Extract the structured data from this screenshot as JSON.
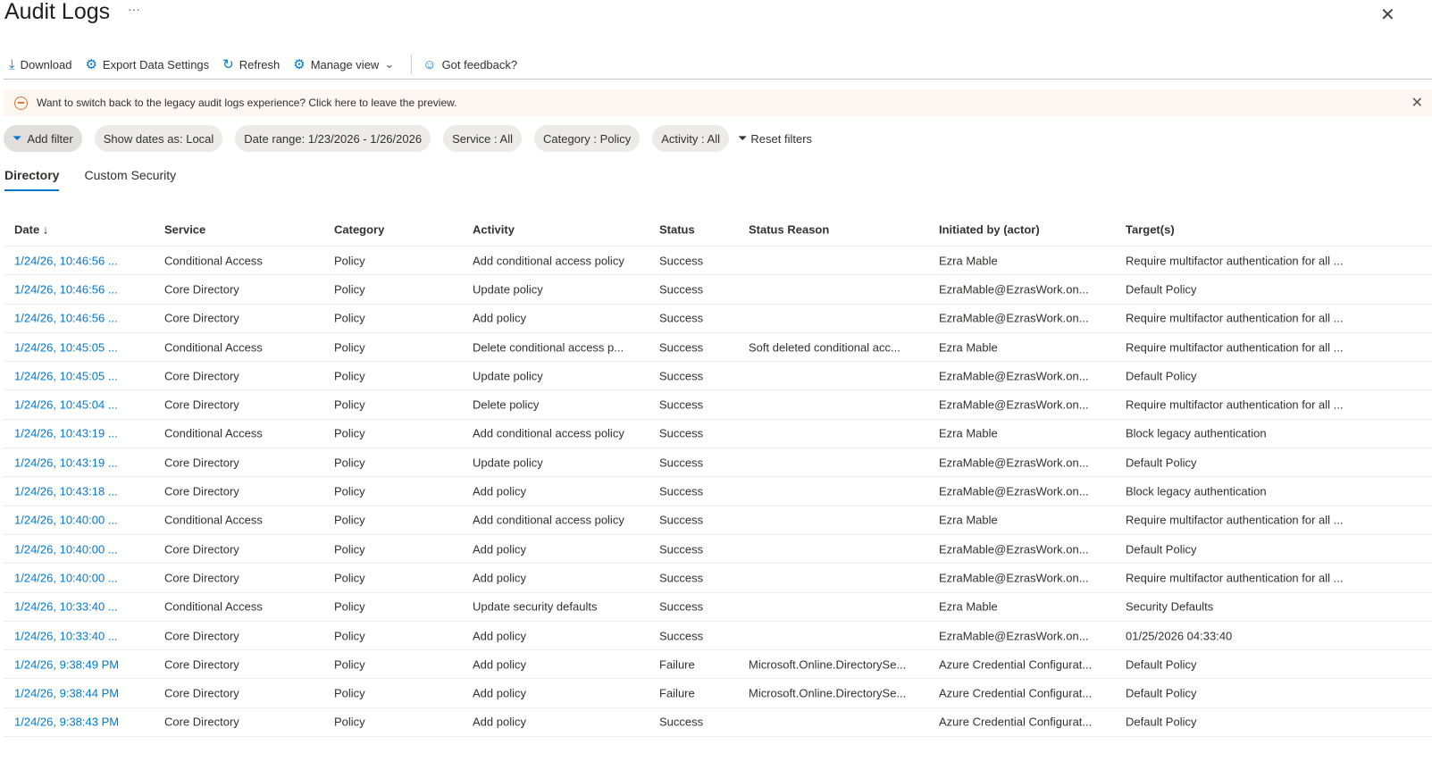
{
  "header": {
    "title": "Audit Logs",
    "more": "···",
    "close": "✕"
  },
  "toolbar": {
    "download": "Download",
    "export": "Export Data Settings",
    "refresh": "Refresh",
    "manage": "Manage view",
    "feedback": "Got feedback?"
  },
  "banner": {
    "text": "Want to switch back to the legacy audit logs experience? Click here to leave the preview."
  },
  "filters": {
    "add": "Add filter",
    "dates": "Show dates as: Local",
    "range": "Date range: 1/23/2026 - 1/26/2026",
    "service": "Service : All",
    "category": "Category : Policy",
    "activity": "Activity : All",
    "reset": "Reset filters"
  },
  "tabs": [
    "Directory",
    "Custom Security"
  ],
  "table": {
    "columns": [
      "Date ↓",
      "Service",
      "Category",
      "Activity",
      "Status",
      "Status Reason",
      "Initiated by (actor)",
      "Target(s)"
    ],
    "rows": [
      [
        "1/24/26, 10:46:56 ...",
        "Conditional Access",
        "Policy",
        "Add conditional access policy",
        "Success",
        "",
        "Ezra Mable",
        "Require multifactor authentication for all ..."
      ],
      [
        "1/24/26, 10:46:56 ...",
        "Core Directory",
        "Policy",
        "Update policy",
        "Success",
        "",
        "EzraMable@EzrasWork.on...",
        "Default Policy"
      ],
      [
        "1/24/26, 10:46:56 ...",
        "Core Directory",
        "Policy",
        "Add policy",
        "Success",
        "",
        "EzraMable@EzrasWork.on...",
        "Require multifactor authentication for all ..."
      ],
      [
        "1/24/26, 10:45:05 ...",
        "Conditional Access",
        "Policy",
        "Delete conditional access p...",
        "Success",
        "Soft deleted conditional acc...",
        "Ezra Mable",
        "Require multifactor authentication for all ..."
      ],
      [
        "1/24/26, 10:45:05 ...",
        "Core Directory",
        "Policy",
        "Update policy",
        "Success",
        "",
        "EzraMable@EzrasWork.on...",
        "Default Policy"
      ],
      [
        "1/24/26, 10:45:04 ...",
        "Core Directory",
        "Policy",
        "Delete policy",
        "Success",
        "",
        "EzraMable@EzrasWork.on...",
        "Require multifactor authentication for all ..."
      ],
      [
        "1/24/26, 10:43:19 ...",
        "Conditional Access",
        "Policy",
        "Add conditional access policy",
        "Success",
        "",
        "Ezra Mable",
        "Block legacy authentication"
      ],
      [
        "1/24/26, 10:43:19 ...",
        "Core Directory",
        "Policy",
        "Update policy",
        "Success",
        "",
        "EzraMable@EzrasWork.on...",
        "Default Policy"
      ],
      [
        "1/24/26, 10:43:18 ...",
        "Core Directory",
        "Policy",
        "Add policy",
        "Success",
        "",
        "EzraMable@EzrasWork.on...",
        "Block legacy authentication"
      ],
      [
        "1/24/26, 10:40:00 ...",
        "Conditional Access",
        "Policy",
        "Add conditional access policy",
        "Success",
        "",
        "Ezra Mable",
        "Require multifactor authentication for all ..."
      ],
      [
        "1/24/26, 10:40:00 ...",
        "Core Directory",
        "Policy",
        "Add policy",
        "Success",
        "",
        "EzraMable@EzrasWork.on...",
        "Default Policy"
      ],
      [
        "1/24/26, 10:40:00 ...",
        "Core Directory",
        "Policy",
        "Add policy",
        "Success",
        "",
        "EzraMable@EzrasWork.on...",
        "Require multifactor authentication for all ..."
      ],
      [
        "1/24/26, 10:33:40 ...",
        "Conditional Access",
        "Policy",
        "Update security defaults",
        "Success",
        "",
        "Ezra Mable",
        "Security Defaults"
      ],
      [
        "1/24/26, 10:33:40 ...",
        "Core Directory",
        "Policy",
        "Add policy",
        "Success",
        "",
        "EzraMable@EzrasWork.on...",
        "01/25/2026 04:33:40"
      ],
      [
        "1/24/26, 9:38:49 PM",
        "Core Directory",
        "Policy",
        "Add policy",
        "Failure",
        "Microsoft.Online.DirectorySe...",
        "Azure Credential Configurat...",
        "Default Policy"
      ],
      [
        "1/24/26, 9:38:44 PM",
        "Core Directory",
        "Policy",
        "Add policy",
        "Failure",
        "Microsoft.Online.DirectorySe...",
        "Azure Credential Configurat...",
        "Default Policy"
      ],
      [
        "1/24/26, 9:38:43 PM",
        "Core Directory",
        "Policy",
        "Add policy",
        "Success",
        "",
        "Azure Credential Configurat...",
        "Default Policy"
      ]
    ]
  }
}
